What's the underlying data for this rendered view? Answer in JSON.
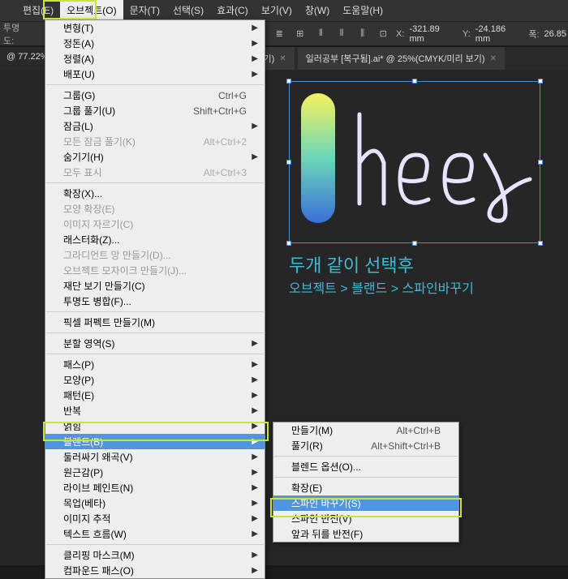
{
  "menubar": {
    "items": [
      "편집(E)",
      "오브젝트(O)",
      "문자(T)",
      "선택(S)",
      "효과(C)",
      "보기(V)",
      "창(W)",
      "도움말(H)"
    ]
  },
  "toolbar": {
    "opacity_label": "투명도:",
    "x_label": "X:",
    "x_value": "-321.89 mm",
    "y_label": "Y:",
    "y_value": "-24.186 mm",
    "w_label": "폭:",
    "w_value": "26.85"
  },
  "tabs": {
    "zoom": "@ 77.22%",
    "tab1_suffix": "/미리 보기)",
    "tab2": "일러공부 [복구됨].ai* @ 25%(CMYK/미리 보기)"
  },
  "captions": {
    "line1": "두개 같이 선택후",
    "line2": "오브젝트 > 블랜드 > 스파인바꾸기"
  },
  "menu": {
    "items": [
      {
        "label": "변형(T)",
        "arrow": true
      },
      {
        "label": "정돈(A)",
        "arrow": true
      },
      {
        "label": "정렬(A)",
        "arrow": true
      },
      {
        "label": "배포(U)",
        "arrow": true
      },
      {
        "sep": true
      },
      {
        "label": "그룹(G)",
        "shortcut": "Ctrl+G"
      },
      {
        "label": "그룹 풀기(U)",
        "shortcut": "Shift+Ctrl+G"
      },
      {
        "label": "잠금(L)",
        "arrow": true
      },
      {
        "label": "모든 잠금 풀기(K)",
        "shortcut": "Alt+Ctrl+2",
        "disabled": true
      },
      {
        "label": "숨기기(H)",
        "arrow": true
      },
      {
        "label": "모두 표시",
        "shortcut": "Alt+Ctrl+3",
        "disabled": true
      },
      {
        "sep": true
      },
      {
        "label": "확장(X)..."
      },
      {
        "label": "모양 확장(E)",
        "disabled": true
      },
      {
        "label": "이미지 자르기(C)",
        "disabled": true
      },
      {
        "label": "래스터화(Z)..."
      },
      {
        "label": "그라디언트 망 만들기(D)...",
        "disabled": true
      },
      {
        "label": "오브젝트 모자이크 만들기(J)...",
        "disabled": true
      },
      {
        "label": "재단 보기 만들기(C)"
      },
      {
        "label": "투명도 병합(F)..."
      },
      {
        "sep": true
      },
      {
        "label": "픽셀 퍼펙트 만들기(M)"
      },
      {
        "sep": true
      },
      {
        "label": "분할 영역(S)",
        "arrow": true
      },
      {
        "sep": true
      },
      {
        "label": "패스(P)",
        "arrow": true
      },
      {
        "label": "모양(P)",
        "arrow": true
      },
      {
        "label": "패턴(E)",
        "arrow": true
      },
      {
        "label": "반복",
        "arrow": true
      },
      {
        "label": "얽힘",
        "arrow": true
      },
      {
        "label": "블렌드(B)",
        "arrow": true,
        "selected": true
      },
      {
        "label": "둘러싸기 왜곡(V)",
        "arrow": true
      },
      {
        "label": "원근감(P)",
        "arrow": true
      },
      {
        "label": "라이브 페인트(N)",
        "arrow": true
      },
      {
        "label": "목업(베타)",
        "arrow": true
      },
      {
        "label": "이미지 추적",
        "arrow": true
      },
      {
        "label": "텍스트 흐름(W)",
        "arrow": true
      },
      {
        "sep": true
      },
      {
        "label": "클리핑 마스크(M)",
        "arrow": true
      },
      {
        "label": "컴파운드 패스(O)",
        "arrow": true
      }
    ]
  },
  "submenu": {
    "items": [
      {
        "label": "만들기(M)",
        "shortcut": "Alt+Ctrl+B"
      },
      {
        "label": "풀기(R)",
        "shortcut": "Alt+Shift+Ctrl+B"
      },
      {
        "sep": true
      },
      {
        "label": "블렌드 옵션(O)..."
      },
      {
        "sep": true
      },
      {
        "label": "확장(E)"
      },
      {
        "label": "스파인 바꾸기(S)",
        "selected": true
      },
      {
        "label": "스파인 반전(V)"
      },
      {
        "label": "앞과 뒤를 반전(F)"
      }
    ]
  }
}
